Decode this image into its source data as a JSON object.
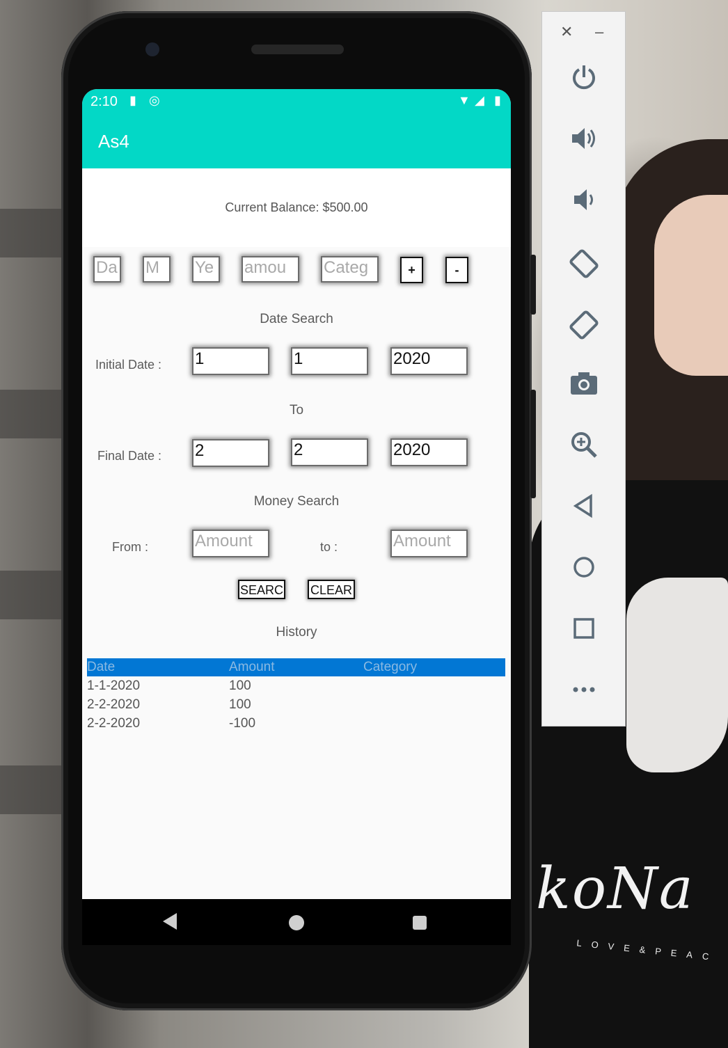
{
  "status_bar": {
    "time": "2:10"
  },
  "app": {
    "title": "As4"
  },
  "balance": {
    "text": "Current Balance: $500.00"
  },
  "entry_row": {
    "day_placeholder": "Da",
    "month_placeholder": "M",
    "year_placeholder": "Ye",
    "amount_placeholder": "amou",
    "category_placeholder": "Categ",
    "add_label": "+",
    "subtract_label": "-"
  },
  "date_search": {
    "heading": "Date Search",
    "initial_label": "Initial Date :",
    "initial": {
      "day": "1",
      "month": "1",
      "year": "2020"
    },
    "to_label": "To",
    "final_label": "Final Date :",
    "final": {
      "day": "2",
      "month": "2",
      "year": "2020"
    }
  },
  "money_search": {
    "heading": "Money Search",
    "from_label": "From :",
    "to_label": "to :",
    "from_placeholder": "Amount",
    "to_placeholder": "Amount"
  },
  "buttons": {
    "search": "SEARC",
    "clear": "CLEAR"
  },
  "history": {
    "heading": "History",
    "columns": [
      "Date",
      "Amount",
      "Category"
    ],
    "rows": [
      {
        "date": "1-1-2020",
        "amount": "100",
        "category": ""
      },
      {
        "date": "2-2-2020",
        "amount": "100",
        "category": ""
      },
      {
        "date": "2-2-2020",
        "amount": "-100",
        "category": ""
      }
    ]
  },
  "emulator_toolbar": {
    "close": "✕",
    "minimize": "–",
    "icons": [
      "power-icon",
      "volume-up-icon",
      "volume-down-icon",
      "rotate-left-icon",
      "rotate-right-icon",
      "camera-icon",
      "zoom-icon",
      "back-icon",
      "home-icon",
      "overview-icon",
      "more-icon"
    ]
  },
  "background_text": {
    "shirt": "koNa",
    "shirt_sub": "LOVE&PEAC"
  },
  "colors": {
    "accent": "#03d8c6",
    "table_header": "#0277d4"
  }
}
